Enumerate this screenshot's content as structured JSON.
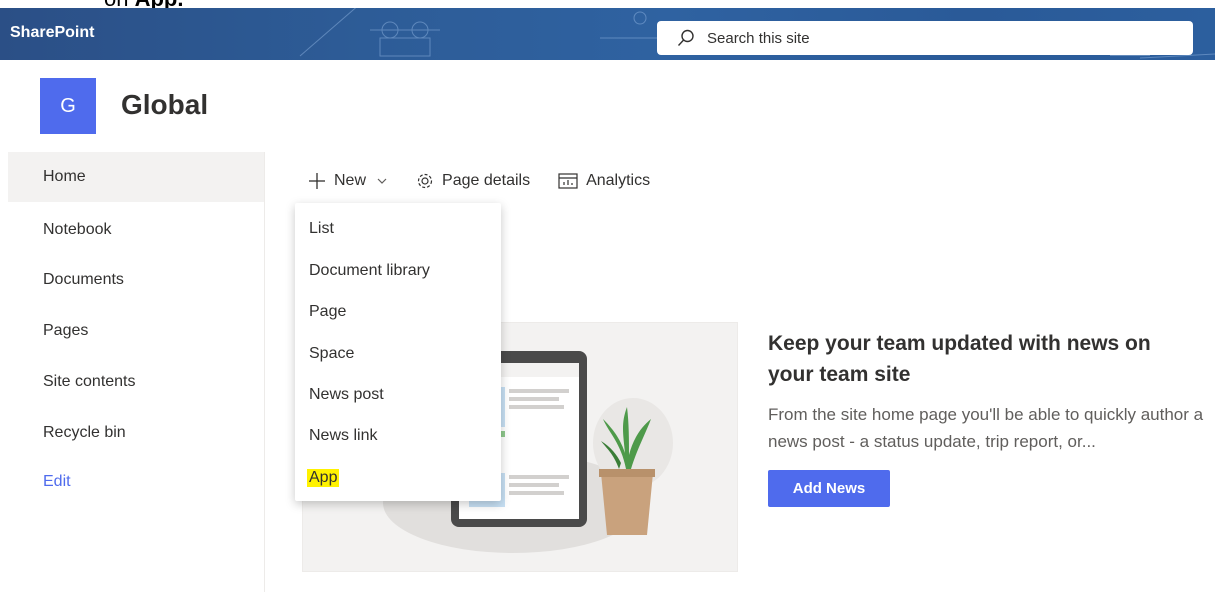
{
  "instruction": {
    "prefix": "on ",
    "target": "App."
  },
  "suitebar": {
    "brand": "SharePoint"
  },
  "search": {
    "placeholder": "Search this site"
  },
  "site": {
    "logo_letter": "G",
    "title": "Global"
  },
  "leftnav": {
    "items": [
      {
        "label": "Home",
        "active": true
      },
      {
        "label": "Notebook"
      },
      {
        "label": "Documents"
      },
      {
        "label": "Pages"
      },
      {
        "label": "Site contents"
      },
      {
        "label": "Recycle bin"
      }
    ],
    "edit_label": "Edit"
  },
  "commandbar": {
    "new_label": "New",
    "page_details_label": "Page details",
    "analytics_label": "Analytics"
  },
  "new_menu": {
    "items": [
      "List",
      "Document library",
      "Page",
      "Space",
      "News post",
      "News link",
      "App"
    ],
    "highlighted": "App"
  },
  "news": {
    "title": "Keep your team updated with news on your team site",
    "description": "From the site home page you'll be able to quickly author a news post - a status update, trip report, or...",
    "button": "Add News"
  },
  "colors": {
    "accent": "#4f6bed",
    "suitebar": "#2d5c97",
    "highlight": "#fff200",
    "nav_active_bg": "#f3f2f1"
  }
}
